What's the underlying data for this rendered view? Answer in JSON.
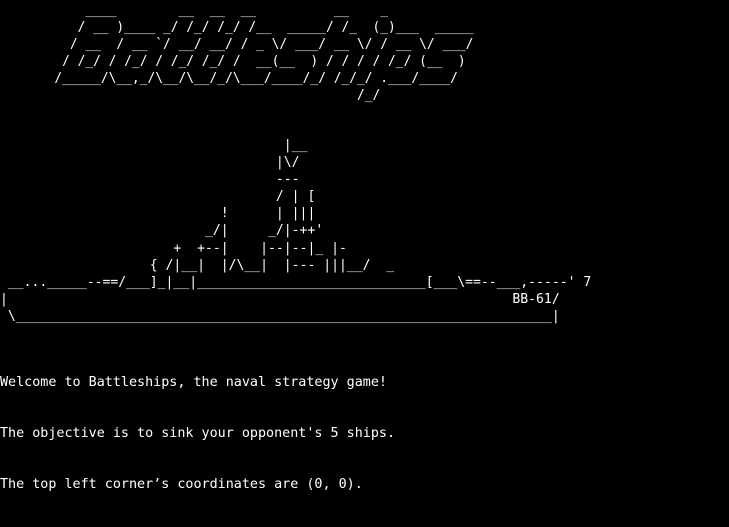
{
  "terminal": {
    "background": "#000000",
    "foreground": "#ffffff"
  },
  "banner_art": "           ____        __  __  __          __    _\n          / __ )____ _/ /_/ /_/ /__  _____/ /_  (_)___  _____\n         / __  / __ `/ __/ __/ / _ \\/ ___/ __ \\/ / __ \\/ ___/\n        / /_/ / /_/ / /_/ /_/ /  __(__  ) / / / / /_/ (__  )\n       /_____/\\__,_/\\__/\\__/_/\\___/____/_/ /_/_/ .___/____/\n                                              /_/",
  "ship_art": "                                    |__\n                                   |\\/\n                                   ---\n                                   / | [\n                            !      | |||\n                          _/|     _/|-++'\n                      +  +--|    |--|--|_ |-\n                   { /|__|  |/\\__|  |--- |||__/  _\n __..._____--==/___]_|__|_____________________________[___\\==--___,-----' 7\n|                                                                BB-61/\n \\____________________________________________________________________|",
  "messages": {
    "welcome": "Welcome to Battleships, the naval strategy game!",
    "objective": "The objective is to sink your opponent's 5 ships.",
    "coordinates": "The top left corner’s coordinates are (0, 0)."
  }
}
